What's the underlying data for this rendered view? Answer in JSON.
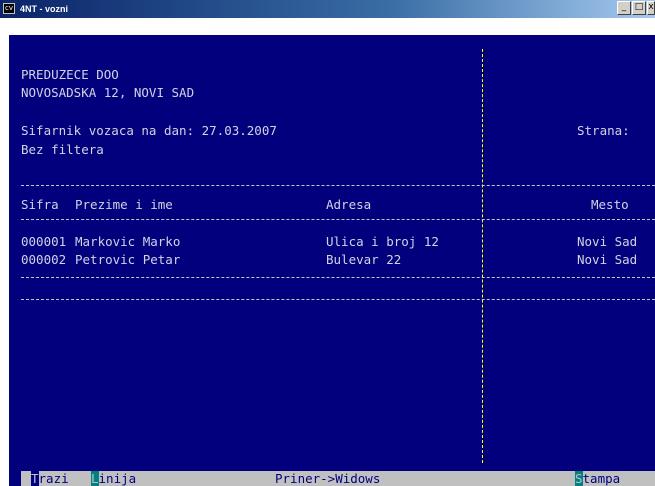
{
  "window": {
    "title": "4NT - vozni",
    "icon_text": "cv",
    "buttons": [
      "_",
      "□",
      "x"
    ]
  },
  "report": {
    "company": "PREDUZECE DOO",
    "address": "NOVOSADSKA 12, NOVI SAD",
    "subtitle": "Sifarnik vozaca na dan: 27.03.2007",
    "filter": "Bez filtera",
    "page_label": "Strana:",
    "columns": {
      "sifra": "Sifra",
      "ime": "Prezime i ime",
      "adresa": "Adresa",
      "mesto": "Mesto"
    },
    "rows": [
      {
        "sifra": "000001",
        "ime": "Markovic Marko",
        "adresa": "Ulica i broj 12",
        "mesto": "Novi Sad"
      },
      {
        "sifra": "000002",
        "ime": "Petrovic Petar",
        "adresa": "Bulevar 22",
        "mesto": "Novi Sad"
      }
    ]
  },
  "menu": {
    "trazi_hotkey": "T",
    "trazi_rest": "razi",
    "linija_hotkey": "L",
    "linija_rest": "inija",
    "printer": "Priner->Widows",
    "stampa_hotkey": "S",
    "stampa_rest": "tampa"
  },
  "colors": {
    "console_bg": "#03007d",
    "console_text": "#cfd4e6",
    "separator": "#ffff00",
    "menu_bg": "#c0c0c0"
  }
}
